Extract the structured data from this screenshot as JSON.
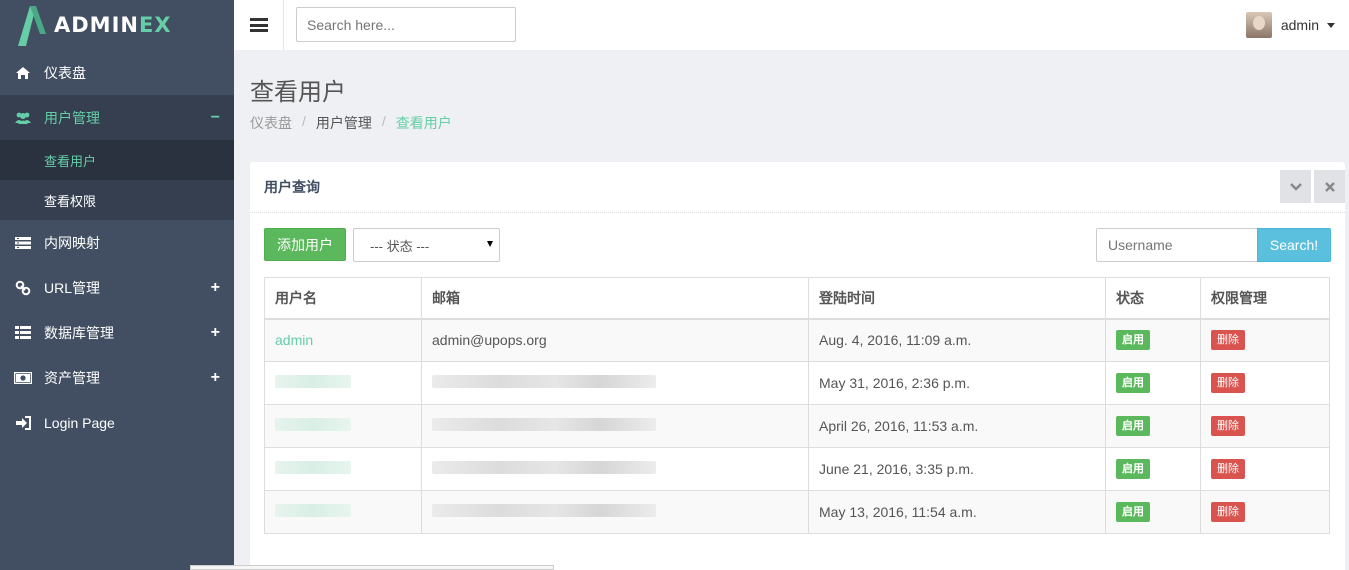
{
  "brand": {
    "name_main": "ADMIN",
    "name_accent": "EX",
    "accent_color": "#65cea7"
  },
  "sidebar": {
    "items": [
      {
        "label": "仪表盘",
        "icon": "home-icon"
      },
      {
        "label": "用户管理",
        "icon": "users-icon",
        "toggle": "−",
        "active": true
      },
      {
        "label": "内网映射",
        "icon": "server-icon"
      },
      {
        "label": "URL管理",
        "icon": "link-icon",
        "toggle": "+"
      },
      {
        "label": "数据库管理",
        "icon": "table-icon",
        "toggle": "+"
      },
      {
        "label": "资产管理",
        "icon": "money-icon",
        "toggle": "+"
      },
      {
        "label": "Login Page",
        "icon": "sign-in-icon"
      }
    ],
    "subitems": [
      {
        "label": "查看用户",
        "current": true
      },
      {
        "label": "查看权限"
      }
    ]
  },
  "header": {
    "search_placeholder": "Search here...",
    "user_name": "admin"
  },
  "page": {
    "title": "查看用户",
    "breadcrumb": [
      "仪表盘",
      "用户管理",
      "查看用户"
    ]
  },
  "panel": {
    "title": "用户查询",
    "add_button": "添加用户",
    "status_select": "--- 状态 ---",
    "username_placeholder": "Username",
    "search_button": "Search!"
  },
  "table": {
    "headers": [
      "用户名",
      "邮箱",
      "登陆时间",
      "状态",
      "权限管理"
    ],
    "rows": [
      {
        "username": "admin",
        "email": "admin@upops.org",
        "login_time": "Aug. 4, 2016, 11:09 a.m.",
        "status": "启用",
        "action": "删除"
      },
      {
        "username": "",
        "email": "",
        "login_time": "May 31, 2016, 2:36 p.m.",
        "status": "启用",
        "action": "删除"
      },
      {
        "username": "",
        "email": "",
        "login_time": "April 26, 2016, 11:53 a.m.",
        "status": "启用",
        "action": "删除"
      },
      {
        "username": "",
        "email": "",
        "login_time": "June 21, 2016, 3:35 p.m.",
        "status": "启用",
        "action": "删除"
      },
      {
        "username": "",
        "email": "",
        "login_time": "May 13, 2016, 11:54 a.m.",
        "status": "启用",
        "action": "删除"
      }
    ]
  }
}
